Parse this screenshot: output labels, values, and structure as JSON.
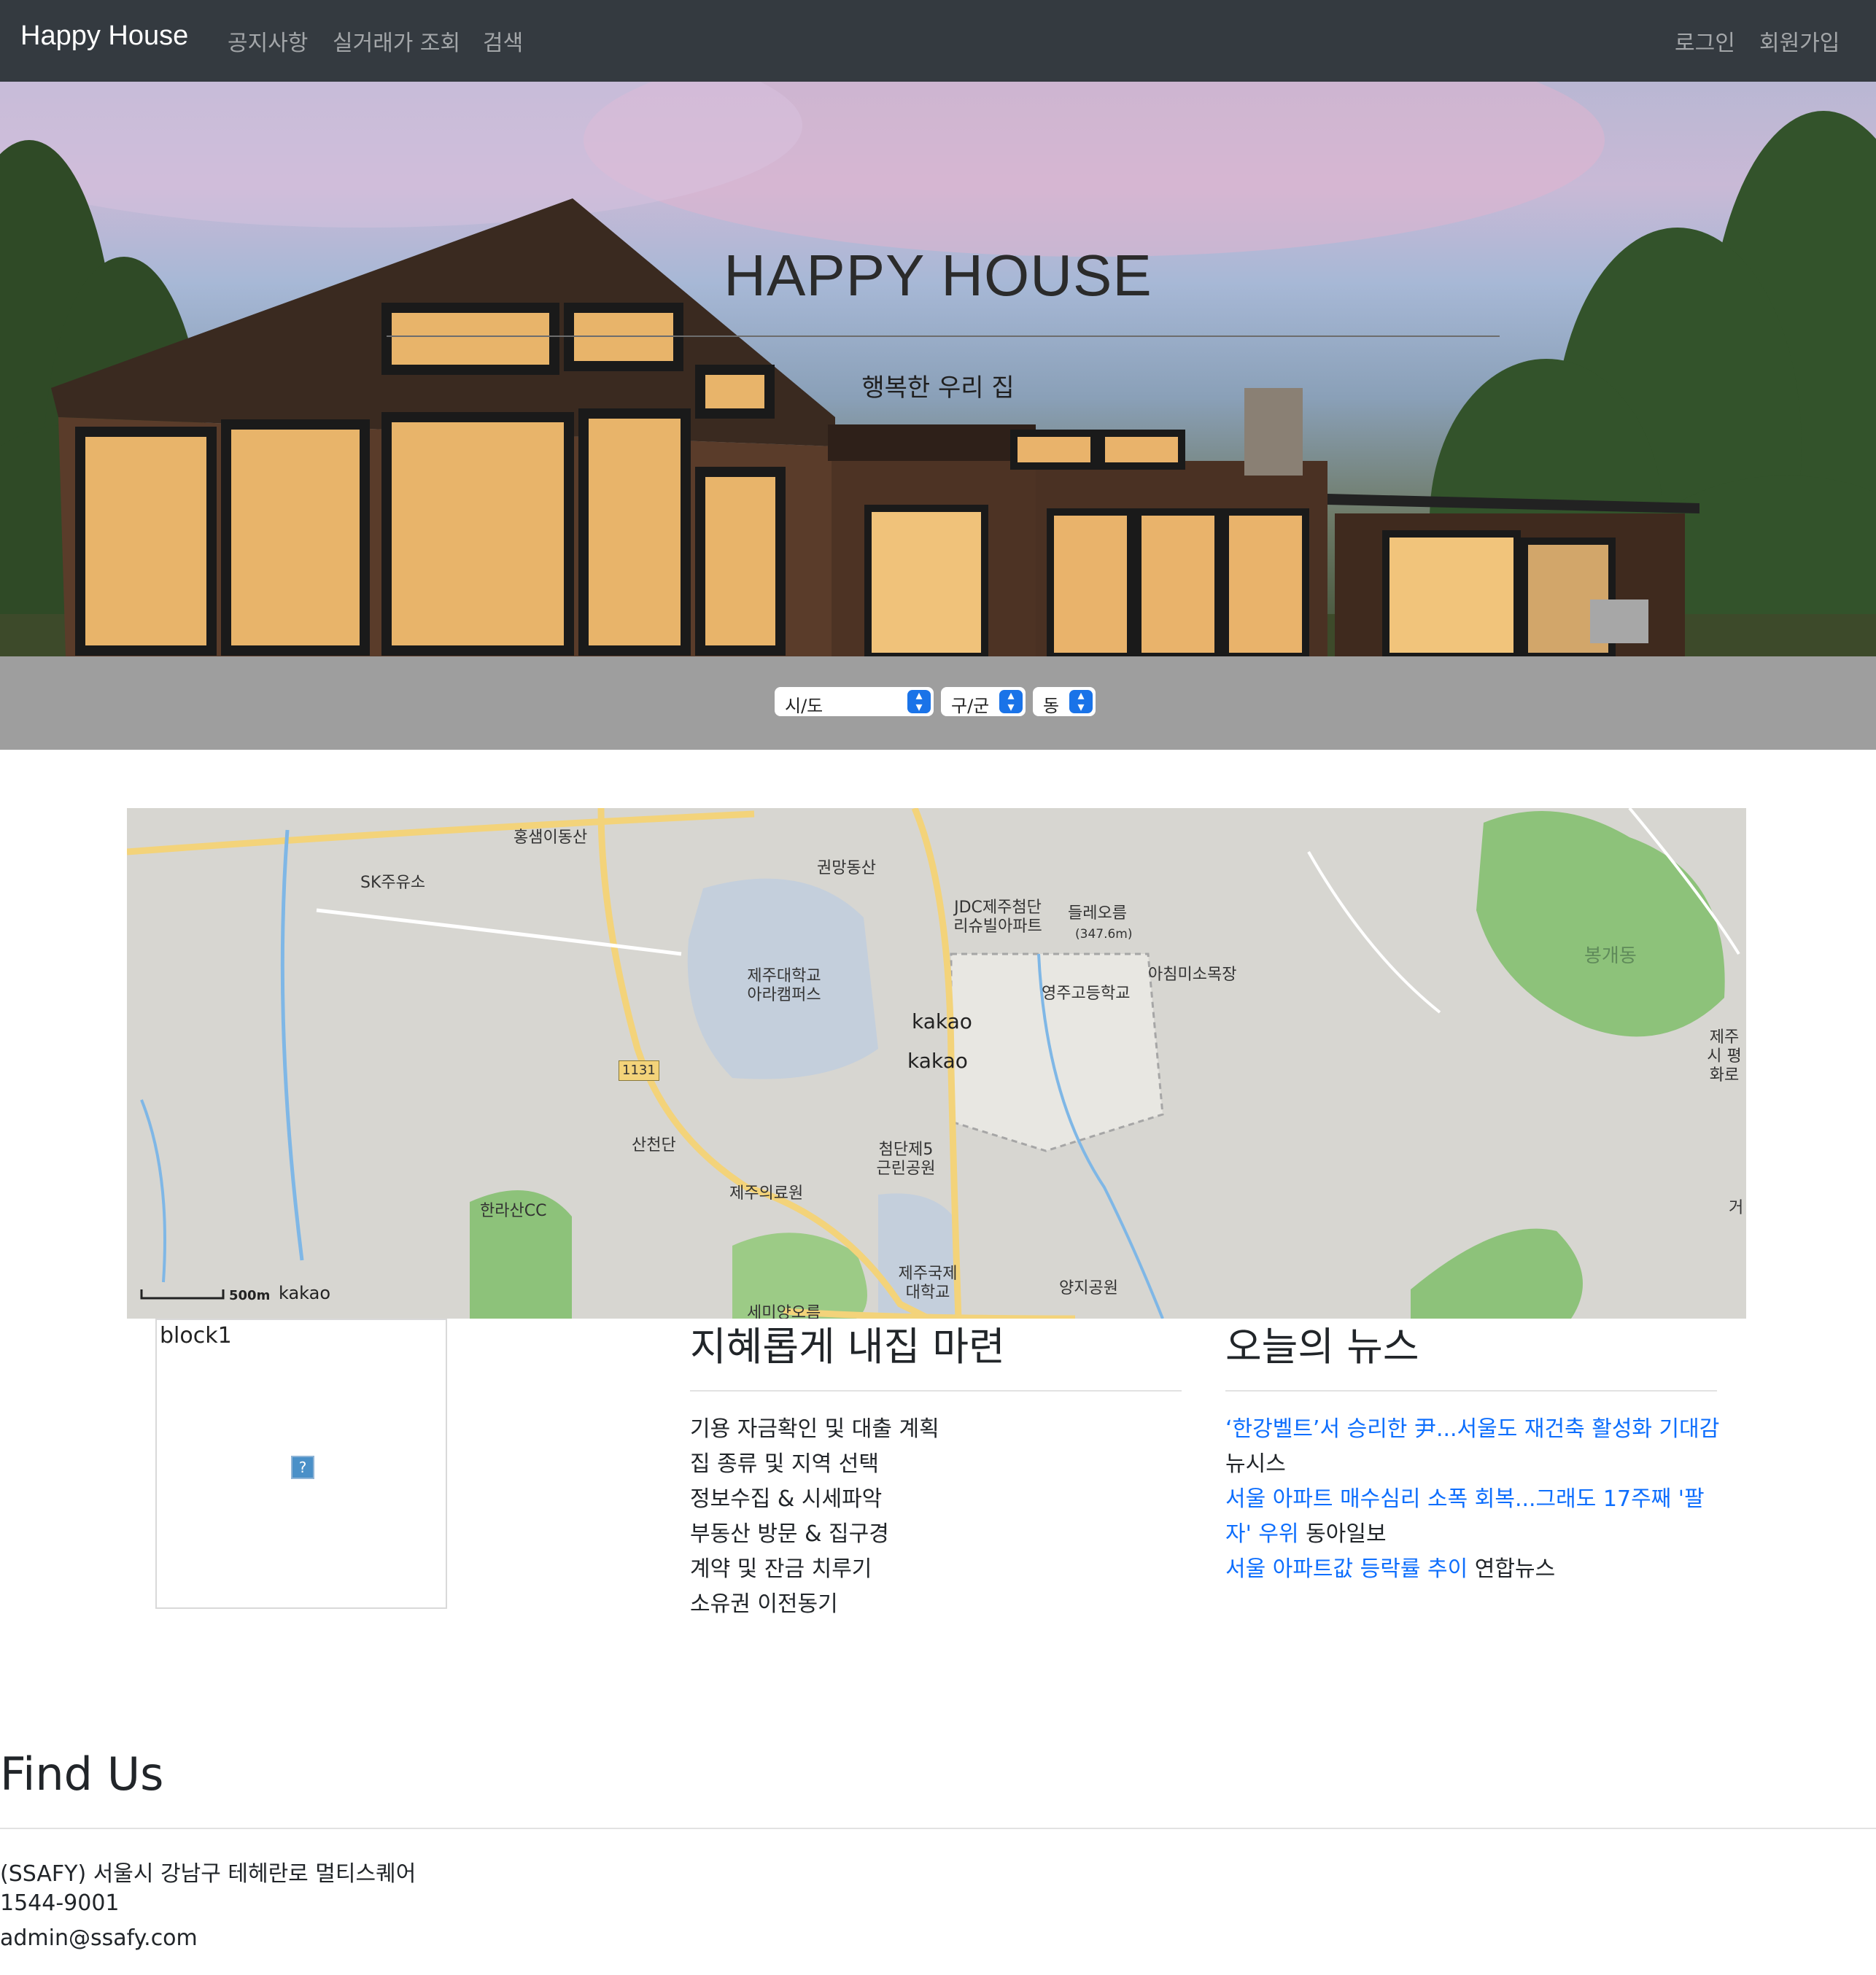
{
  "navbar": {
    "brand": "Happy House",
    "links": [
      "공지사항",
      "실거래가 조회",
      "검색"
    ],
    "right_links": [
      "로그인",
      "회원가입"
    ]
  },
  "hero": {
    "title": "HAPPY HOUSE",
    "subtitle": "행복한 우리 집"
  },
  "selects": {
    "sido": "시/도",
    "gugun": "구/군",
    "dong": "동"
  },
  "map": {
    "labels": [
      "홍샘이동산",
      "SK주유소",
      "권망동산",
      "JDC제주첨단 리슈빌아파트",
      "들레오름",
      "(347.6m)",
      "아침미소목장",
      "영주고등학교",
      "제주대학교 아라캠퍼스",
      "봉개동",
      "제주시 평화로",
      "산천단",
      "첨단제5 근린공원",
      "제주의료원",
      "한라산CC",
      "제주국제 대학교",
      "양지공원",
      "세미양오름",
      "거"
    ],
    "road_number": "1131",
    "marker_labels": [
      "kakao",
      "kakao"
    ],
    "scale": "500m",
    "attribution": "kakao"
  },
  "block1": {
    "label": "block1",
    "broken_image_mark": "?"
  },
  "plan": {
    "title": "지혜롭게 내집 마련",
    "steps": [
      "기용 자금확인 및 대출 계획",
      "집 종류 및 지역 선택",
      "정보수집 & 시세파악",
      "부동산 방문 & 집구경",
      "계약 및 잔금 치루기",
      "소유권 이전동기"
    ]
  },
  "news": {
    "title": "오늘의 뉴스",
    "items": [
      {
        "headline": "‘한강벨트’서 승리한 尹...서울도 재건축 활성화 기대감",
        "source": "뉴시스"
      },
      {
        "headline": "서울 아파트 매수심리 소폭 회복...그래도 17주째 '팔자' 우위",
        "source": "동아일보"
      },
      {
        "headline": "서울 아파트값 등락률 추이",
        "source": "연합뉴스"
      }
    ]
  },
  "footer": {
    "title": "Find Us",
    "address": "(SSAFY) 서울시 강남구 테헤란로 멀티스퀘어",
    "phone": "1544-9001",
    "email": "admin@ssafy.com"
  },
  "colors": {
    "navbar_bg": "#343a40",
    "select_bar_bg": "#9e9e9e",
    "link_blue": "#0d6efd"
  }
}
